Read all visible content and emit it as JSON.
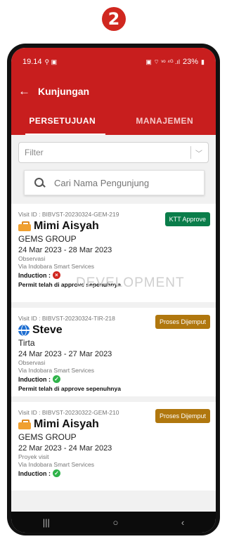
{
  "step_badge": "2",
  "status_bar": {
    "time": "19.14",
    "notif_icons": "⚲ ▣",
    "right_icons": "▣ ⌔ ᵛᵒ ⁴ᴳ .ıl",
    "battery": "23%"
  },
  "app_bar": {
    "title": "Kunjungan"
  },
  "tabs": [
    {
      "label": "PERSETUJUAN"
    },
    {
      "label": "MANAJEMEN"
    }
  ],
  "filter": {
    "placeholder": "Filter"
  },
  "search": {
    "placeholder": "Cari Nama Pengunjung"
  },
  "visits": [
    {
      "visit_id": "Visit ID : BIBVST-20230324-GEM-219",
      "name": "Mimi Aisyah",
      "icon": "briefcase-icon",
      "company": "GEMS GROUP",
      "dates": "24 Mar 2023 - 28 Mar 2023",
      "purpose": "Observasi",
      "via": "Via Indobara Smart Services",
      "induction_label": "Induction :",
      "induction_status": "failed",
      "permit": "Permit telah di approve sepenuhnya",
      "status_label": "KTT Approve",
      "status_color": "#0a7d4a"
    },
    {
      "visit_id": "Visit ID : BIBVST-20230324-TIR-218",
      "name": "Steve",
      "icon": "globe-icon",
      "company": "Tirta",
      "dates": "24 Mar 2023 - 27 Mar 2023",
      "purpose": "Observasi",
      "via": "Via Indobara Smart Services",
      "induction_label": "Induction :",
      "induction_status": "passed",
      "permit": "Permit telah di approve sepenuhnya",
      "status_label": "Proses Dijemput",
      "status_color": "#b0770e"
    },
    {
      "visit_id": "Visit ID : BIBVST-20230322-GEM-210",
      "name": "Mimi Aisyah",
      "icon": "briefcase-icon",
      "company": "GEMS GROUP",
      "dates": "22 Mar 2023 - 24 Mar 2023",
      "purpose": "Proyek visit",
      "via": "Via Indobara Smart Services",
      "induction_label": "Induction :",
      "induction_status": "passed",
      "permit": "",
      "status_label": "Proses Dijemput",
      "status_color": "#b0770e"
    }
  ],
  "watermark": "DEVELOPMENT",
  "nav_bar": {
    "recents": "|||",
    "home": "○",
    "back": "‹"
  }
}
